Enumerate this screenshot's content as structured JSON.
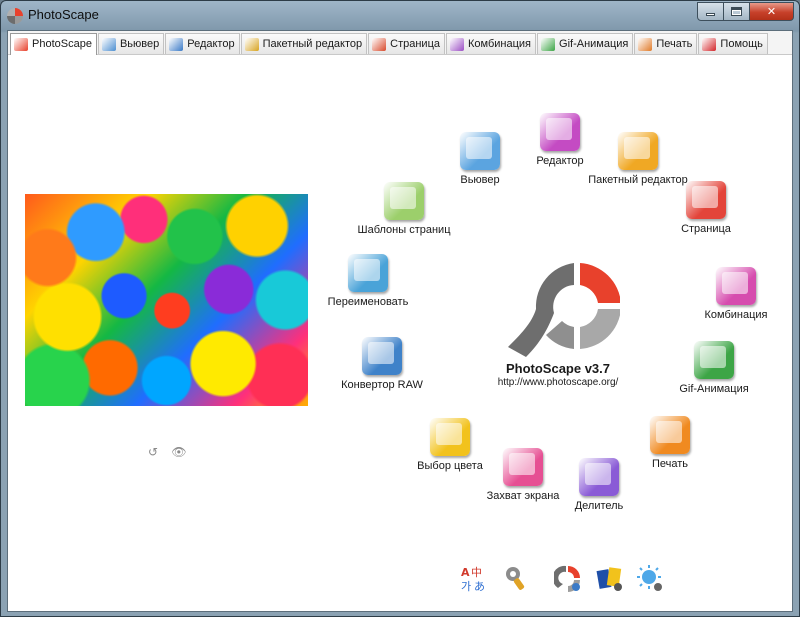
{
  "window": {
    "title": "PhotoScape"
  },
  "tabs": [
    {
      "label": "PhotoScape",
      "icon": "photoscape-icon",
      "color": "#e8412c",
      "active": true
    },
    {
      "label": "Вьювер",
      "icon": "viewer-icon",
      "color": "#4d8fd1",
      "active": false
    },
    {
      "label": "Редактор",
      "icon": "editor-icon",
      "color": "#3a7ac7",
      "active": false
    },
    {
      "label": "Пакетный редактор",
      "icon": "batch-editor-icon",
      "color": "#d8a421",
      "active": false
    },
    {
      "label": "Страница",
      "icon": "page-icon",
      "color": "#d84a2c",
      "active": false
    },
    {
      "label": "Комбинация",
      "icon": "combine-icon",
      "color": "#9c4fc5",
      "active": false
    },
    {
      "label": "Gif-Анимация",
      "icon": "gif-animation-icon",
      "color": "#3da546",
      "active": false
    },
    {
      "label": "Печать",
      "icon": "print-icon",
      "color": "#e07a28",
      "active": false
    },
    {
      "label": "Помощь",
      "icon": "help-icon",
      "color": "#d3262a",
      "active": false
    }
  ],
  "photo_controls": {
    "rotate": "↺",
    "view": "👁"
  },
  "menu_circle": [
    {
      "label": "Вьювер",
      "icon": "viewer-icon",
      "color": "#5ba4e0"
    },
    {
      "label": "Редактор",
      "icon": "editor-icon",
      "color": "#c44bc3"
    },
    {
      "label": "Пакетный редактор",
      "icon": "batch-editor-icon",
      "color": "#f0a824"
    },
    {
      "label": "Страница",
      "icon": "page-icon",
      "color": "#e3443a"
    },
    {
      "label": "Комбинация",
      "icon": "combine-icon",
      "color": "#d64cae"
    },
    {
      "label": "Gif-Анимация",
      "icon": "gif-animation-icon",
      "color": "#3da546"
    },
    {
      "label": "Печать",
      "icon": "print-icon",
      "color": "#f08a20"
    },
    {
      "label": "Делитель",
      "icon": "splitter-icon",
      "color": "#8a5bd6"
    },
    {
      "label": "Захват экрана",
      "icon": "screen-capture-icon",
      "color": "#e64f93"
    },
    {
      "label": "Выбор цвета",
      "icon": "color-picker-icon",
      "color": "#f2c21c"
    },
    {
      "label": "Конвертор RAW",
      "icon": "raw-converter-icon",
      "color": "#3f82c9"
    },
    {
      "label": "Переименовать",
      "icon": "rename-icon",
      "color": "#4aa3d8"
    },
    {
      "label": "Шаблоны страниц",
      "icon": "page-templates-icon",
      "color": "#9ccf6b"
    }
  ],
  "logo": {
    "name": "PhotoScape v3.7",
    "url": "http://www.photoscape.org/",
    "accent": "#e8412c"
  },
  "bottom_tools": [
    {
      "icon": "language-icon",
      "text": "A中 가あ"
    },
    {
      "icon": "tools-icon"
    },
    {
      "icon": "photoscape-update-icon"
    },
    {
      "icon": "photo-sharing-icon"
    },
    {
      "icon": "brightness-icon"
    }
  ]
}
